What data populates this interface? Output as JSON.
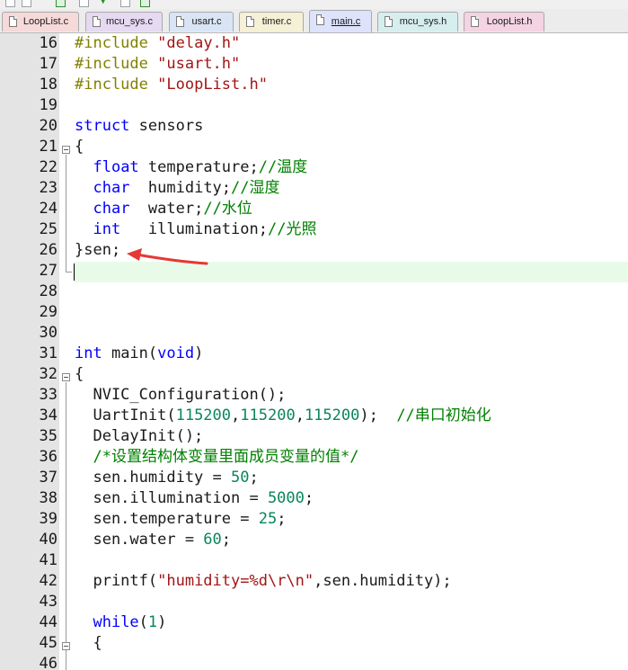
{
  "toolbar": {
    "icons": [
      "new-file-icon",
      "save-icon",
      "build-icon",
      "download-icon",
      "debug-icon"
    ]
  },
  "tabs": [
    {
      "label": "LoopList.c",
      "active": false,
      "color": "#f6d9d9"
    },
    {
      "label": "mcu_sys.c",
      "active": false,
      "color": "#e6d9f2"
    },
    {
      "label": "usart.c",
      "active": false,
      "color": "#d9e5f5"
    },
    {
      "label": "timer.c",
      "active": false,
      "color": "#f5f0d6"
    },
    {
      "label": "main.c",
      "active": true,
      "color": "#dde3fb"
    },
    {
      "label": "mcu_sys.h",
      "active": false,
      "color": "#d7eeee"
    },
    {
      "label": "LoopList.h",
      "active": false,
      "color": "#f4d3e3"
    }
  ],
  "editor": {
    "lines": [
      {
        "n": "16",
        "text": "#include \"delay.h\""
      },
      {
        "n": "17",
        "text": "#include \"usart.h\""
      },
      {
        "n": "18",
        "text": "#include \"LoopList.h\""
      },
      {
        "n": "19",
        "text": ""
      },
      {
        "n": "20",
        "text": "struct sensors"
      },
      {
        "n": "21",
        "text": "{"
      },
      {
        "n": "22",
        "text": "  float temperature;//温度"
      },
      {
        "n": "23",
        "text": "  char  humidity;//湿度"
      },
      {
        "n": "24",
        "text": "  char  water;//水位"
      },
      {
        "n": "25",
        "text": "  int   illumination;//光照"
      },
      {
        "n": "26",
        "text": "}sen;"
      },
      {
        "n": "27",
        "text": ""
      },
      {
        "n": "28",
        "text": ""
      },
      {
        "n": "29",
        "text": ""
      },
      {
        "n": "30",
        "text": ""
      },
      {
        "n": "31",
        "text": "int main(void)"
      },
      {
        "n": "32",
        "text": "{"
      },
      {
        "n": "33",
        "text": "  NVIC_Configuration();"
      },
      {
        "n": "34",
        "text": "  UartInit(115200,115200,115200);  //串口初始化"
      },
      {
        "n": "35",
        "text": "  DelayInit();"
      },
      {
        "n": "36",
        "text": "  /*设置结构体变量里面成员变量的值*/"
      },
      {
        "n": "37",
        "text": "  sen.humidity = 50;"
      },
      {
        "n": "38",
        "text": "  sen.illumination = 5000;"
      },
      {
        "n": "39",
        "text": "  sen.temperature = 25;"
      },
      {
        "n": "40",
        "text": "  sen.water = 60;"
      },
      {
        "n": "41",
        "text": ""
      },
      {
        "n": "42",
        "text": "  printf(\"humidity=%d\\r\\n\",sen.humidity);"
      },
      {
        "n": "43",
        "text": ""
      },
      {
        "n": "44",
        "text": "  while(1)"
      },
      {
        "n": "45",
        "text": "  {"
      },
      {
        "n": "46",
        "text": ""
      }
    ]
  },
  "colors": {
    "preprocessor": "#808000",
    "string": "#a31515",
    "keyword": "#0000ff",
    "number": "#098658",
    "comment": "#008000",
    "annotation_arrow": "#e53935",
    "current_line": "#e8fbe8"
  }
}
